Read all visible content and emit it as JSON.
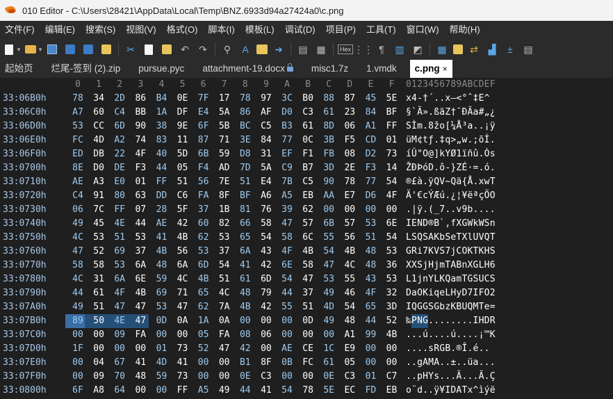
{
  "window": {
    "title": "010 Editor - C:\\Users\\28421\\AppData\\Local\\Temp\\BNZ.6933d94a27424a0\\c.png"
  },
  "menu": [
    "文件(F)",
    "编辑(E)",
    "搜索(S)",
    "视图(V)",
    "格式(O)",
    "脚本(I)",
    "模板(L)",
    "调试(D)",
    "项目(P)",
    "工具(T)",
    "窗口(W)",
    "帮助(H)"
  ],
  "toolbar": {
    "icons": [
      "new-file-icon",
      "open-folder-icon",
      "save-icon",
      "save-all-icon",
      "copy-file-icon",
      "folder-icon",
      "cut-icon",
      "copy-icon",
      "paste-icon",
      "undo-icon",
      "redo-icon",
      "find-icon",
      "replace-icon",
      "find-in-files-icon",
      "goto-icon",
      "compare-icon",
      "history-icon",
      "hex-icon",
      "ascii-icon",
      "paragraph-icon",
      "columns-icon",
      "highlight-icon",
      "calculator-icon",
      "inspector-icon",
      "convert-icon",
      "histogram-icon",
      "checksum-icon",
      "template-icon"
    ],
    "hex_label": "Hex"
  },
  "tabs": [
    {
      "label": "起始页"
    },
    {
      "label": "烂尾-签到 (2).zip"
    },
    {
      "label": "pursue.pyc"
    },
    {
      "label": "attachment-19.docx",
      "locked": true
    },
    {
      "label": "misc1.7z"
    },
    {
      "label": "1.vmdk"
    },
    {
      "label": "c.png",
      "active": true,
      "close": "×"
    }
  ],
  "hex": {
    "column_headers": [
      "0",
      "1",
      "2",
      "3",
      "4",
      "5",
      "6",
      "7",
      "8",
      "9",
      "A",
      "B",
      "C",
      "D",
      "E",
      "F"
    ],
    "ascii_header": "0123456789ABCDEF",
    "rows": [
      {
        "addr": "33:06B0h",
        "bytes": [
          "78",
          "34",
          "2D",
          "86",
          "B4",
          "0E",
          "7F",
          "17",
          "78",
          "97",
          "3C",
          "B0",
          "88",
          "87",
          "45",
          "5E"
        ],
        "ascii": "x4-†´..x—<°ˆ‡E^"
      },
      {
        "addr": "33:06C0h",
        "bytes": [
          "A7",
          "60",
          "C4",
          "BB",
          "1A",
          "DF",
          "E4",
          "5A",
          "86",
          "AF",
          "D0",
          "C3",
          "61",
          "23",
          "84",
          "BF"
        ],
        "ascii": "§`Ä».ßäZ†¯ÐÃa#„¿"
      },
      {
        "addr": "33:06D0h",
        "bytes": [
          "53",
          "CC",
          "6D",
          "90",
          "38",
          "9E",
          "6F",
          "5B",
          "BC",
          "C5",
          "B3",
          "61",
          "8D",
          "06",
          "A1",
          "FF"
        ],
        "ascii": "SÌm.8žo[¼Å³a..¡ÿ"
      },
      {
        "addr": "33:06E0h",
        "bytes": [
          "FC",
          "4D",
          "A2",
          "74",
          "83",
          "11",
          "87",
          "71",
          "3E",
          "84",
          "77",
          "0C",
          "3B",
          "F5",
          "CD",
          "01"
        ],
        "ascii": "üM¢tƒ.‡q>„w.;õÍ."
      },
      {
        "addr": "33:06F0h",
        "bytes": [
          "ED",
          "DB",
          "22",
          "4F",
          "40",
          "5D",
          "6B",
          "59",
          "D8",
          "31",
          "EF",
          "F1",
          "FB",
          "08",
          "D2",
          "73"
        ],
        "ascii": "íÛ\"O@]kYØ1ïñû.Òs"
      },
      {
        "addr": "33:0700h",
        "bytes": [
          "8E",
          "D0",
          "DE",
          "F3",
          "44",
          "05",
          "F4",
          "AD",
          "7D",
          "5A",
          "C9",
          "B7",
          "3D",
          "2E",
          "F3",
          "14"
        ],
        "ascii": "ŽÐÞóD.ô-}ZÉ·=.ó."
      },
      {
        "addr": "33:0710h",
        "bytes": [
          "AE",
          "A3",
          "E0",
          "01",
          "FF",
          "51",
          "56",
          "7E",
          "51",
          "E4",
          "7B",
          "C5",
          "90",
          "78",
          "77",
          "54"
        ],
        "ascii": "®£à.ÿQV~Qä{Å.xwT"
      },
      {
        "addr": "33:0720h",
        "bytes": [
          "C4",
          "91",
          "80",
          "63",
          "DD",
          "C6",
          "FA",
          "8F",
          "BF",
          "A6",
          "A5",
          "EB",
          "AA",
          "E7",
          "D6",
          "4F"
        ],
        "ascii": "Ä'€cÝÆú.¿¦¥ëªçÖO"
      },
      {
        "addr": "33:0730h",
        "bytes": [
          "06",
          "7C",
          "FF",
          "07",
          "28",
          "5F",
          "37",
          "1B",
          "81",
          "76",
          "39",
          "62",
          "00",
          "00",
          "00",
          "00"
        ],
        "ascii": ".|ÿ.(_7..v9b...."
      },
      {
        "addr": "33:0740h",
        "bytes": [
          "49",
          "45",
          "4E",
          "44",
          "AE",
          "42",
          "60",
          "82",
          "66",
          "58",
          "47",
          "57",
          "6B",
          "57",
          "53",
          "6E"
        ],
        "ascii": "IEND®B`‚fXGWkWSn"
      },
      {
        "addr": "33:0750h",
        "bytes": [
          "4C",
          "53",
          "51",
          "53",
          "41",
          "4B",
          "62",
          "53",
          "65",
          "54",
          "58",
          "6C",
          "55",
          "56",
          "51",
          "54"
        ],
        "ascii": "LSQSAKbSeTXlUVQT"
      },
      {
        "addr": "33:0760h",
        "bytes": [
          "47",
          "52",
          "69",
          "37",
          "4B",
          "56",
          "53",
          "37",
          "6A",
          "43",
          "4F",
          "4B",
          "54",
          "4B",
          "48",
          "53"
        ],
        "ascii": "GRi7KVS7jCOKTKHS"
      },
      {
        "addr": "33:0770h",
        "bytes": [
          "58",
          "58",
          "53",
          "6A",
          "48",
          "6A",
          "6D",
          "54",
          "41",
          "42",
          "6E",
          "58",
          "47",
          "4C",
          "48",
          "36"
        ],
        "ascii": "XXSjHjmTABnXGLH6"
      },
      {
        "addr": "33:0780h",
        "bytes": [
          "4C",
          "31",
          "6A",
          "6E",
          "59",
          "4C",
          "4B",
          "51",
          "61",
          "6D",
          "54",
          "47",
          "53",
          "55",
          "43",
          "53"
        ],
        "ascii": "L1jnYLKQamTGSUCS"
      },
      {
        "addr": "33:0790h",
        "bytes": [
          "44",
          "61",
          "4F",
          "4B",
          "69",
          "71",
          "65",
          "4C",
          "48",
          "79",
          "44",
          "37",
          "49",
          "46",
          "4F",
          "32"
        ],
        "ascii": "DaOKiqeLHyD7IFO2"
      },
      {
        "addr": "33:07A0h",
        "bytes": [
          "49",
          "51",
          "47",
          "47",
          "53",
          "47",
          "62",
          "7A",
          "4B",
          "42",
          "55",
          "51",
          "4D",
          "54",
          "65",
          "3D"
        ],
        "ascii": "IQGGSGbzKBUQMTe="
      },
      {
        "addr": "33:07B0h",
        "bytes": [
          "89",
          "50",
          "4E",
          "47",
          "0D",
          "0A",
          "1A",
          "0A",
          "00",
          "00",
          "00",
          "0D",
          "49",
          "48",
          "44",
          "52"
        ],
        "ascii": "‰PNG........IHDR"
      },
      {
        "addr": "33:07C0h",
        "bytes": [
          "00",
          "00",
          "09",
          "FA",
          "00",
          "00",
          "05",
          "FA",
          "08",
          "06",
          "00",
          "00",
          "00",
          "A1",
          "99",
          "4B"
        ],
        "ascii": "...ú....ú....¡™K"
      },
      {
        "addr": "33:07D0h",
        "bytes": [
          "1F",
          "00",
          "00",
          "00",
          "01",
          "73",
          "52",
          "47",
          "42",
          "00",
          "AE",
          "CE",
          "1C",
          "E9",
          "00",
          "00"
        ],
        "ascii": "....sRGB.®Î.é.."
      },
      {
        "addr": "33:07E0h",
        "bytes": [
          "00",
          "04",
          "67",
          "41",
          "4D",
          "41",
          "00",
          "00",
          "B1",
          "8F",
          "0B",
          "FC",
          "61",
          "05",
          "00",
          "00"
        ],
        "ascii": "..gAMA..±..üa..."
      },
      {
        "addr": "33:07F0h",
        "bytes": [
          "00",
          "09",
          "70",
          "48",
          "59",
          "73",
          "00",
          "00",
          "0E",
          "C3",
          "00",
          "00",
          "0E",
          "C3",
          "01",
          "C7"
        ],
        "ascii": "..pHYs...Ã...Ã.Ç"
      },
      {
        "addr": "33:0800h",
        "bytes": [
          "6F",
          "A8",
          "64",
          "00",
          "00",
          "FF",
          "A5",
          "49",
          "44",
          "41",
          "54",
          "78",
          "5E",
          "EC",
          "FD",
          "EB"
        ],
        "ascii": "o¨d..ÿ¥IDATx^ìýë"
      }
    ],
    "selection": {
      "row": 16,
      "start": 0,
      "end": 3,
      "cursor": 0
    }
  },
  "colors": {
    "background": "#1f1f1f",
    "even_column": "#9ecbf0",
    "odd_column": "#ffffff",
    "address": "#a7c7e7",
    "selection": "#264f78"
  }
}
